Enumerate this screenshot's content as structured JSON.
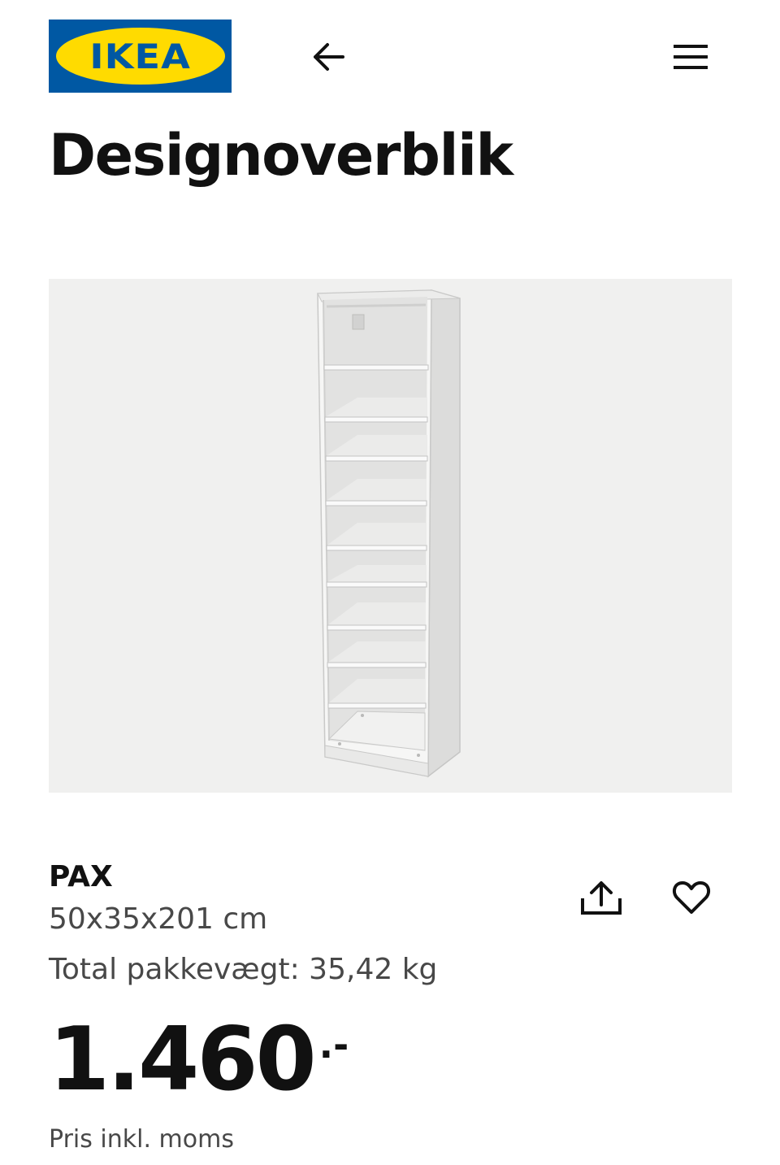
{
  "header": {
    "logo_text": "IKEA",
    "back_icon": "arrow-left-icon",
    "menu_icon": "hamburger-menu-icon"
  },
  "page": {
    "title": "Designoverblik"
  },
  "product": {
    "image_icon": "pax-wardrobe-frame-with-shelves",
    "name": "PAX",
    "dimensions": "50x35x201 cm",
    "weight": "Total pakkevægt: 35,42 kg",
    "price_integer": "1.460",
    "price_suffix": ".-",
    "price_note": "Pris inkl. moms",
    "share_icon": "share-upload-icon",
    "favorite_icon": "heart-icon"
  },
  "colors": {
    "ikea_blue": "#0058a3",
    "ikea_yellow": "#ffdb00",
    "image_background": "#f0f0ef"
  }
}
